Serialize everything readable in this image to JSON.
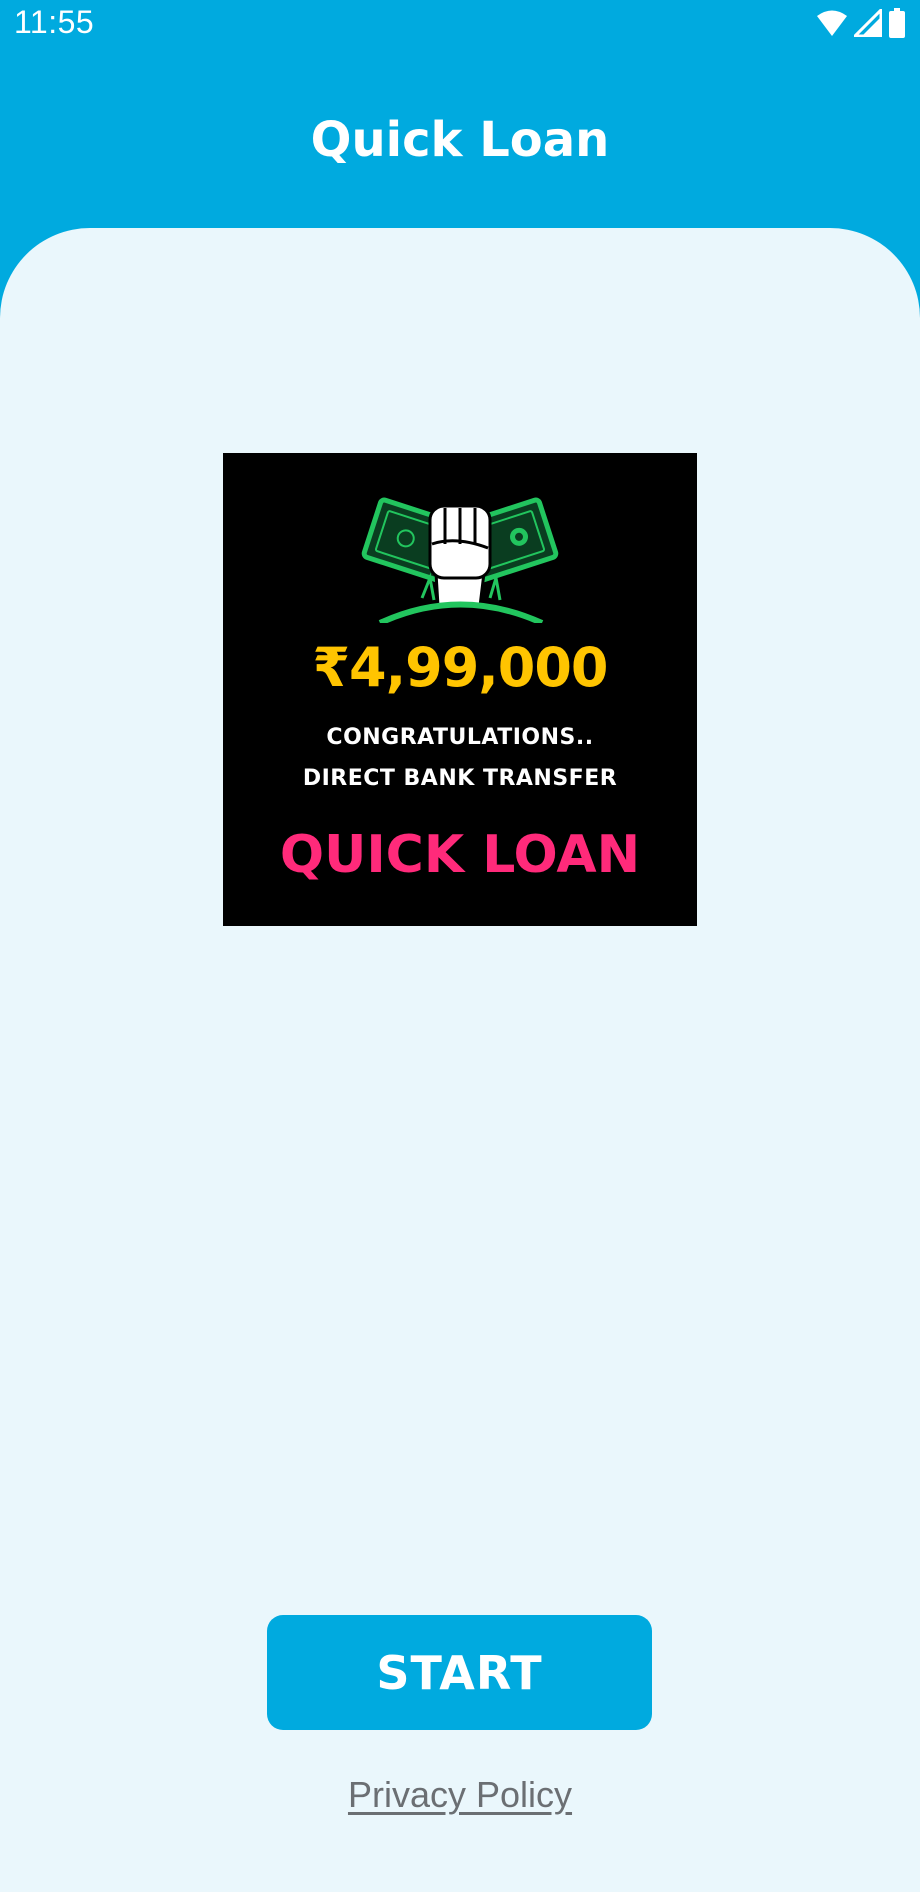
{
  "status_bar": {
    "time": "11:55",
    "icons": [
      "wifi-icon",
      "signal-icon",
      "battery-icon"
    ]
  },
  "app_bar": {
    "title": "Quick Loan"
  },
  "banner": {
    "amount": "₹4,99,000",
    "line1": "CONGRATULATIONS..",
    "line2": "DIRECT BANK TRANSFER",
    "brand": "QUICK LOAN",
    "illustration": "fist-holding-cash-icon"
  },
  "actions": {
    "start_label": "START",
    "privacy_label": "Privacy Policy"
  },
  "colors": {
    "primary": "#00AADF",
    "background": "#EAF7FC",
    "amount": "#FFC400",
    "brand": "#FF2A7A",
    "cash": "#22C55E",
    "link": "#6b6f73"
  }
}
